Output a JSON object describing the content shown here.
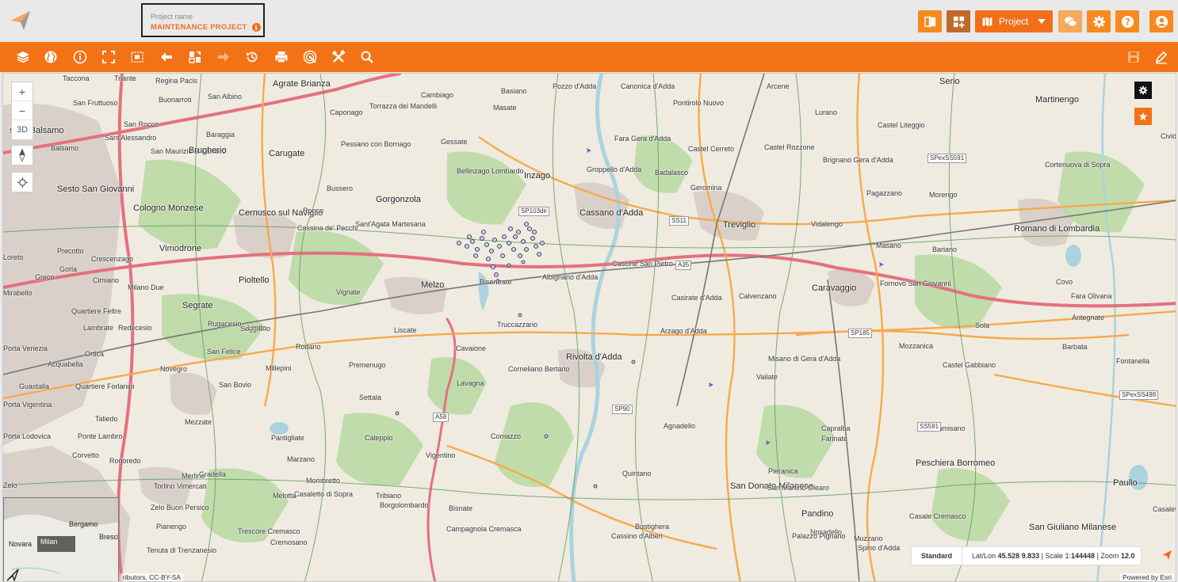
{
  "header": {
    "project_label": "Project name",
    "project_name": "MAINTENANCE PROJECT",
    "info_glyph": "i",
    "project_dropdown_label": "Project",
    "buttons": [
      {
        "name": "compare-icon",
        "color": "#f6891f"
      },
      {
        "name": "add-widget-icon",
        "color": "#c0692a"
      },
      {
        "name": "chat-icon",
        "color": "#f6a85b"
      },
      {
        "name": "gear-icon",
        "color": "#f6891f"
      },
      {
        "name": "help-icon",
        "color": "#f6891f"
      },
      {
        "name": "user-icon",
        "color": "#f6891f"
      }
    ]
  },
  "toolbar": {
    "tools": [
      "layers-icon",
      "globe-icon",
      "info-icon",
      "fullscreen-icon",
      "select-area-icon",
      "back-arrow-icon",
      "tiles-icon",
      "forward-arrow-icon",
      "history-icon",
      "print-icon",
      "radar-icon",
      "tools-icon",
      "search-icon"
    ],
    "right_tools": [
      "save-icon",
      "edit-pen-icon"
    ],
    "accent_color": "#f47216"
  },
  "map": {
    "controls": {
      "zoom_in": "+",
      "zoom_out": "−",
      "mode_3d": "3D"
    },
    "places": [
      {
        "name": "Taccona"
      },
      {
        "name": "Triante"
      },
      {
        "name": "Regina Pacis"
      },
      {
        "name": "Agrate Brianza"
      },
      {
        "name": "Buonarroti"
      },
      {
        "name": "San Fruttuoso"
      },
      {
        "name": "San Albino"
      },
      {
        "name": "Caponago"
      },
      {
        "name": "Torrazza dei Mandelli"
      },
      {
        "name": "Cambiago"
      },
      {
        "name": "Basiano"
      },
      {
        "name": "Masate"
      },
      {
        "name": "Pozzo d'Adda"
      },
      {
        "name": "Canonica d'Adda"
      },
      {
        "name": "Pontirolo Nuovo"
      },
      {
        "name": "Arcene"
      },
      {
        "name": "Lurano"
      },
      {
        "name": "Serio"
      },
      {
        "name": "Martinengo"
      },
      {
        "name": "sello Balsamo"
      },
      {
        "name": "San Rocco"
      },
      {
        "name": "Sant'Alessandro"
      },
      {
        "name": "Baraggia"
      },
      {
        "name": "Balsamo"
      },
      {
        "name": "San Maurizio al Lambro"
      },
      {
        "name": "Brugherio"
      },
      {
        "name": "Carugate"
      },
      {
        "name": "Pessano con Bornago"
      },
      {
        "name": "Gessate"
      },
      {
        "name": "Fara Gera d'Adda"
      },
      {
        "name": "Castel Cerreto"
      },
      {
        "name": "Castel Liteggio"
      },
      {
        "name": "Castel Rozzone"
      },
      {
        "name": "Cividat al Piano"
      },
      {
        "name": "Bellinzago Lombardo"
      },
      {
        "name": "Inzago"
      },
      {
        "name": "Groppello d'Adda"
      },
      {
        "name": "Badalasco"
      },
      {
        "name": "Brignano Gera d'Adda"
      },
      {
        "name": "Cortenuova di Sopra"
      },
      {
        "name": "Sesto San Giovanni"
      },
      {
        "name": "Bussero"
      },
      {
        "name": "Gorgonzola"
      },
      {
        "name": "Geromina"
      },
      {
        "name": "Pagazzano"
      },
      {
        "name": "Morengo"
      },
      {
        "name": "Cologno Monzese"
      },
      {
        "name": "Cernusco sul Naviglio"
      },
      {
        "name": "Ronco"
      },
      {
        "name": "Cassano d'Adda"
      },
      {
        "name": "Treviglio"
      },
      {
        "name": "Vidalengo"
      },
      {
        "name": "Romano di Lombardia"
      },
      {
        "name": "Sant'Agata Martesana"
      },
      {
        "name": "Cassina de' Pecchi"
      },
      {
        "name": "Precotto"
      },
      {
        "name": "Vimodrone"
      },
      {
        "name": "Crescenzago"
      },
      {
        "name": "Loreto"
      },
      {
        "name": "Gorla"
      },
      {
        "name": "Cascine San Pietro"
      },
      {
        "name": "Masano"
      },
      {
        "name": "Bariano"
      },
      {
        "name": "Greco"
      },
      {
        "name": "Cimiano"
      },
      {
        "name": "Pioltello"
      },
      {
        "name": "Melzo"
      },
      {
        "name": "Bisentrate"
      },
      {
        "name": "Albignano d'Adda"
      },
      {
        "name": "Fornovo San Giovanni"
      },
      {
        "name": "Caravaggio"
      },
      {
        "name": "Covo"
      },
      {
        "name": "Mirabello"
      },
      {
        "name": "Milano Due"
      },
      {
        "name": "Quartiere Feltre"
      },
      {
        "name": "Segrate"
      },
      {
        "name": "Vignate"
      },
      {
        "name": "Casirate d'Adda"
      },
      {
        "name": "Calvenzano"
      },
      {
        "name": "Fara Olivana"
      },
      {
        "name": "Lambrate"
      },
      {
        "name": "Redecesio"
      },
      {
        "name": "Rugacesio"
      },
      {
        "name": "Seggiano"
      },
      {
        "name": "Limito"
      },
      {
        "name": "Liscate"
      },
      {
        "name": "Truccazzano"
      },
      {
        "name": "Arzago d'Adda"
      },
      {
        "name": "Antegnate"
      },
      {
        "name": "Sola"
      },
      {
        "name": "Porta Venezia"
      },
      {
        "name": "Ortica"
      },
      {
        "name": "San Felice"
      },
      {
        "name": "Rodano"
      },
      {
        "name": "Cavaione"
      },
      {
        "name": "Mozzanica"
      },
      {
        "name": "Barbata"
      },
      {
        "name": "Acquabella"
      },
      {
        "name": "Novegro"
      },
      {
        "name": "Millepini"
      },
      {
        "name": "Premenugo"
      },
      {
        "name": "Rivolta d'Adda"
      },
      {
        "name": "Misano di Gera d'Adda"
      },
      {
        "name": "Castel Gabbiano"
      },
      {
        "name": "Fontanella"
      },
      {
        "name": "Corneliano Bertario"
      },
      {
        "name": "Lavagna"
      },
      {
        "name": "Vailate"
      },
      {
        "name": "Guastalla"
      },
      {
        "name": "Quartiere Forlanini"
      },
      {
        "name": "San Bovio"
      },
      {
        "name": "Settala"
      },
      {
        "name": "Porta Vigentina"
      },
      {
        "name": "Taliedo"
      },
      {
        "name": "Mezzate"
      },
      {
        "name": "Agnadello"
      },
      {
        "name": "Capralba"
      },
      {
        "name": "Farinate"
      },
      {
        "name": "Camisano"
      },
      {
        "name": "Porta Lodovica"
      },
      {
        "name": "Ponte Lambro"
      },
      {
        "name": "Pantigliate"
      },
      {
        "name": "Caleppio"
      },
      {
        "name": "Comazzo"
      },
      {
        "name": "Corvetto"
      },
      {
        "name": "Rogoredo"
      },
      {
        "name": "Vigentino"
      },
      {
        "name": "Peschiera Borromeo"
      },
      {
        "name": "Merlino"
      },
      {
        "name": "Casale Cremasco"
      },
      {
        "name": "Zelo"
      },
      {
        "name": "Marzano"
      },
      {
        "name": "Gradella"
      },
      {
        "name": "Pieranica"
      },
      {
        "name": "Quintano"
      },
      {
        "name": "Mombretto"
      },
      {
        "name": "Casaletto di Sopra"
      },
      {
        "name": "San Donato Milanese"
      },
      {
        "name": "San Martino Olearo"
      },
      {
        "name": "Paullo"
      },
      {
        "name": "Torlino Vimercati"
      },
      {
        "name": "Melotta"
      },
      {
        "name": "Tribiano"
      },
      {
        "name": "Zelo Buon Persico"
      },
      {
        "name": "Casaletto Vaprio"
      },
      {
        "name": "Borgolombardo"
      },
      {
        "name": "Bisnate"
      },
      {
        "name": "Pandino"
      },
      {
        "name": "Pianengo"
      },
      {
        "name": "Campagnola Cremasca"
      },
      {
        "name": "Bustighera"
      },
      {
        "name": "Nosadello"
      },
      {
        "name": "Trescore Cremasco"
      },
      {
        "name": "San Giuliano Milanese"
      },
      {
        "name": "Muzzano"
      },
      {
        "name": "Spino d'Adda"
      },
      {
        "name": "Cremosano"
      },
      {
        "name": "Cassino d'Alberi"
      },
      {
        "name": "Palazzo Pignano"
      },
      {
        "name": "Tenuta di Trenzanesio"
      }
    ],
    "road_labels": [
      "SP103dir",
      "SS11",
      "A35",
      "SPexSS591",
      "SP185",
      "SP90",
      "A58",
      "SS591",
      "SPexSS498"
    ],
    "status": {
      "basemap": "Standard",
      "latlon_label": "Lat/Lon",
      "lat": "45.528",
      "lon": "9.833",
      "scale_label": "Scale 1:",
      "scale": "144448",
      "zoom_label": "Zoom",
      "zoom": "12.0"
    },
    "attribution_left": "ributors, CC-BY-SA",
    "attribution_right": "Powered by Esri",
    "overview": {
      "places": [
        "Bergamo",
        "Novara",
        "Milan",
        "Bresci"
      ]
    },
    "colors": {
      "road_red": "#e5707e",
      "road_orange": "#f7a94b",
      "green": "#b7d9a1",
      "water": "#aad3df",
      "urban": "#d9d0c9",
      "points": "#9ea9f4"
    }
  }
}
